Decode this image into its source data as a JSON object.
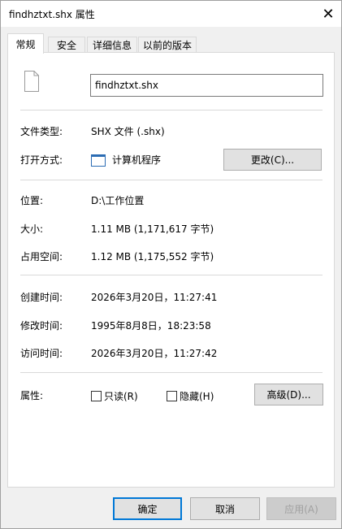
{
  "window": {
    "title": "findhztxt.shx 属性",
    "close_glyph": "✕"
  },
  "tabs": [
    {
      "label": "常规",
      "active": true
    },
    {
      "label": "安全",
      "active": false
    },
    {
      "label": "详细信息",
      "active": false
    },
    {
      "label": "以前的版本",
      "active": false
    }
  ],
  "general": {
    "file_name": "findhztxt.shx",
    "file_type_label": "文件类型:",
    "file_type_value": "SHX 文件 (.shx)",
    "opens_with_label": "打开方式:",
    "opens_with_value": "计算机程序",
    "change_button": "更改(C)...",
    "location_label": "位置:",
    "location_value": "D:\\工作位置",
    "size_label": "大小:",
    "size_value": "1.11 MB (1,171,617 字节)",
    "size_on_disk_label": "占用空间:",
    "size_on_disk_value": "1.12 MB (1,175,552 字节)",
    "created_label": "创建时间:",
    "created_value": "2026年3月20日，11:27:41",
    "modified_label": "修改时间:",
    "modified_value": "1995年8月8日，18:23:58",
    "accessed_label": "访问时间:",
    "accessed_value": "2026年3月20日，11:27:42",
    "attributes_label": "属性:",
    "readonly_label": "只读(R)",
    "hidden_label": "隐藏(H)",
    "advanced_button": "高级(D)..."
  },
  "footer": {
    "ok": "确定",
    "cancel": "取消",
    "apply": "应用(A)"
  }
}
